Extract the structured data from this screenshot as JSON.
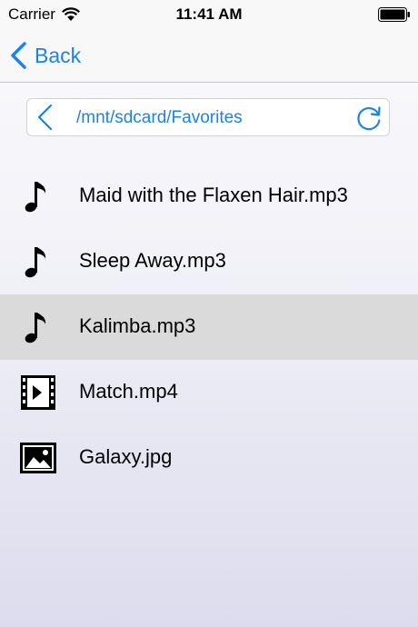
{
  "status_bar": {
    "carrier": "Carrier",
    "time": "11:41 AM"
  },
  "nav": {
    "back_label": "Back"
  },
  "path_bar": {
    "path": "/mnt/sdcard/Favorites"
  },
  "files": [
    {
      "name": "Maid with the Flaxen Hair.mp3",
      "icon": "music-note-icon",
      "selected": false
    },
    {
      "name": "Sleep Away.mp3",
      "icon": "music-note-icon",
      "selected": false
    },
    {
      "name": "Kalimba.mp3",
      "icon": "music-note-icon",
      "selected": true
    },
    {
      "name": "Match.mp4",
      "icon": "video-file-icon",
      "selected": false
    },
    {
      "name": "Galaxy.jpg",
      "icon": "image-file-icon",
      "selected": false
    }
  ],
  "colors": {
    "accent": "#1a82f0",
    "selected_row": "#dadada"
  }
}
